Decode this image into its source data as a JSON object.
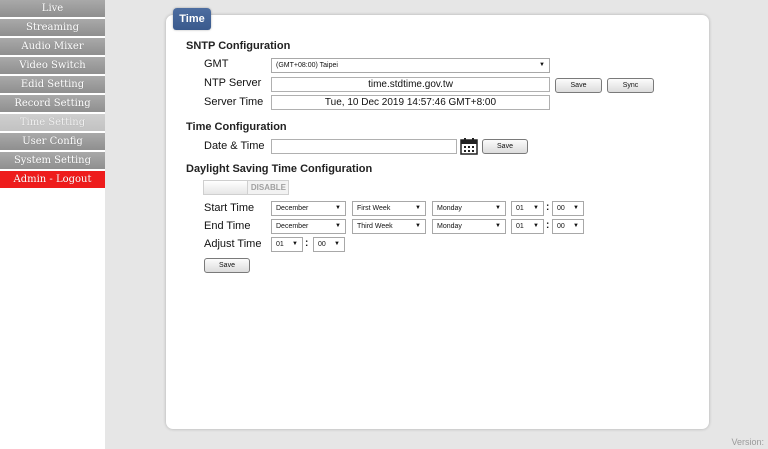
{
  "sidebar": {
    "items": [
      {
        "label": "Live"
      },
      {
        "label": "Streaming"
      },
      {
        "label": "Audio Mixer"
      },
      {
        "label": "Video Switch"
      },
      {
        "label": "Edid Setting"
      },
      {
        "label": "Record Setting"
      },
      {
        "label": "Time Setting"
      },
      {
        "label": "User Config"
      },
      {
        "label": "System Setting"
      },
      {
        "label": "Admin - Logout"
      }
    ]
  },
  "panel": {
    "title": "Time"
  },
  "sntp": {
    "title": "SNTP Configuration",
    "gmt_label": "GMT",
    "gmt_value": "(GMT+08:00) Taipei",
    "ntp_label": "NTP Server",
    "ntp_value": "time.stdtime.gov.tw",
    "server_time_label": "Server Time",
    "server_time_value": "Tue, 10 Dec 2019 14:57:46 GMT+8:00",
    "save_label": "Save",
    "sync_label": "Sync"
  },
  "time_config": {
    "title": "Time Configuration",
    "datetime_label": "Date & Time",
    "datetime_value": "",
    "save_label": "Save"
  },
  "dst": {
    "title": "Daylight Saving Time Configuration",
    "toggle_label": "DISABLE",
    "start_label": "Start Time",
    "start": {
      "month": "December",
      "week": "First Week",
      "day": "Monday",
      "hour": "01",
      "minute": "00"
    },
    "end_label": "End Time",
    "end": {
      "month": "December",
      "week": "Third Week",
      "day": "Monday",
      "hour": "01",
      "minute": "00"
    },
    "adjust_label": "Adjust Time",
    "adjust": {
      "hour": "01",
      "minute": "00"
    },
    "colon": ":",
    "save_label": "Save"
  },
  "footer": {
    "version_label": "Version:"
  },
  "colors": {
    "nav_gray": "#999999",
    "nav_active": "#c8c8c8",
    "logout_red": "#ee1c1c",
    "tab_blue": "#44649a"
  },
  "icons": {
    "dropdown": "▼",
    "calendar": "calendar-icon"
  }
}
